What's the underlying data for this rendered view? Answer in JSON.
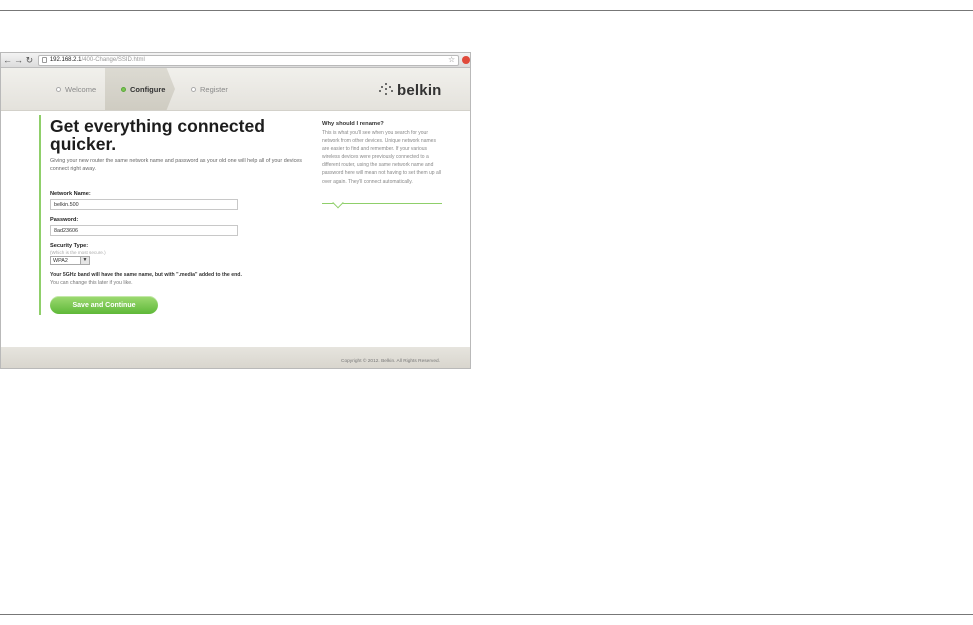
{
  "browser": {
    "url_host": "192.168.2.1",
    "url_path": "/400-Change/SSID.html"
  },
  "header": {
    "steps": [
      {
        "label": "Welcome"
      },
      {
        "label": "Configure"
      },
      {
        "label": "Register"
      }
    ],
    "logo_text": "belkin"
  },
  "main": {
    "title": "Get everything connected quicker.",
    "intro": "Giving your new router the same network name and password as your old one will help all of your devices connect right away.",
    "network_name": {
      "label": "Network Name:",
      "value": "belkin.500"
    },
    "password": {
      "label": "Password:",
      "value": "8ad23606"
    },
    "security": {
      "label": "Security Type:",
      "hint": "(Which is the most secure.)",
      "value": "WPA2"
    },
    "note_bold": "Your 5GHz band will have the same name, but with \".media\" added to the end.",
    "note_sub": "You can change this later if you like.",
    "save_label": "Save and Continue"
  },
  "sidebar": {
    "title": "Why should I rename?",
    "body": "This is what you'll see when you search for your network from other devices. Unique network names are easier to find and remember. If your various wireless devices were previously connected to a different router, using the same network name and password here will mean not having to set them up all over again. They'll connect automatically."
  },
  "footer": {
    "copyright": "Copyright © 2012. Belkin. All Rights Reserved."
  },
  "colors": {
    "accent_green": "#7cc653",
    "header_bg": "#ebe9e3"
  }
}
